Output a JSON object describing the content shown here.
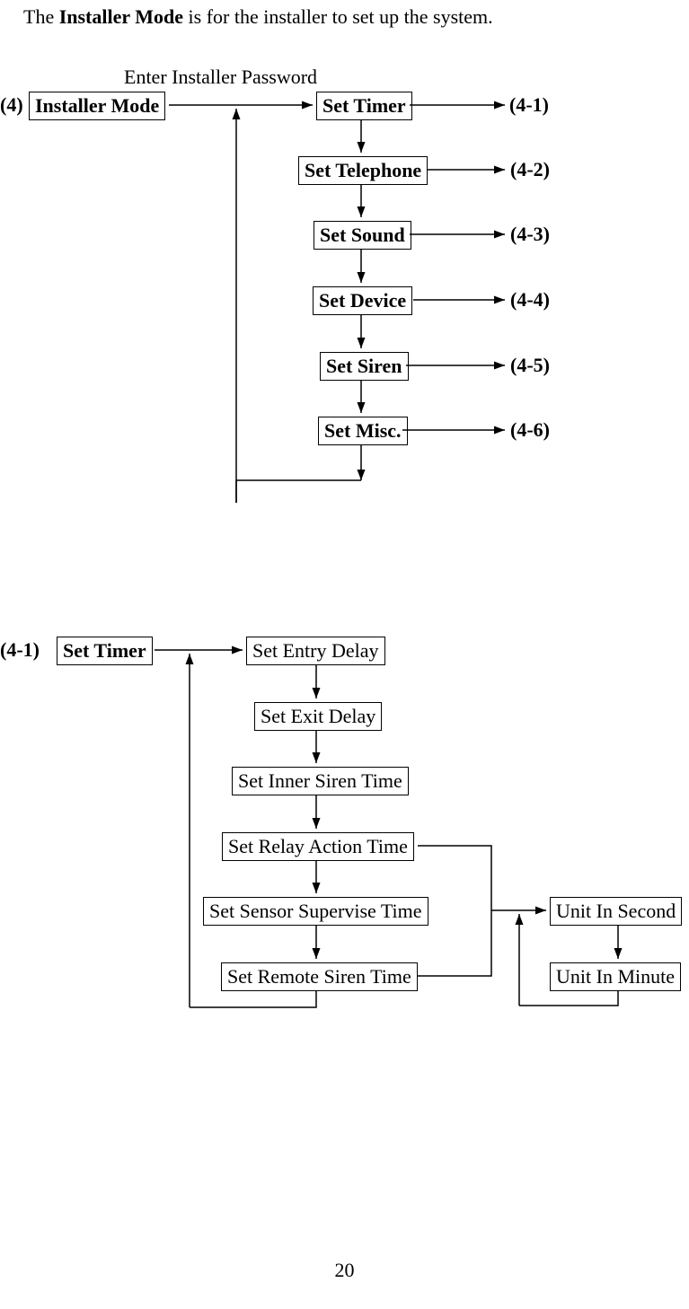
{
  "intro_prefix": "The ",
  "intro_bold": "Installer Mode",
  "intro_suffix": " is for the installer to set up the system.",
  "password_label": "Enter Installer Password",
  "d1": {
    "root_ref": "(4)",
    "root_label": "Installer Mode",
    "items": [
      {
        "label": "Set Timer",
        "ref": "(4-1)"
      },
      {
        "label": "Set Telephone",
        "ref": "(4-2)"
      },
      {
        "label": "Set Sound",
        "ref": "(4-3)"
      },
      {
        "label": "Set Device",
        "ref": "(4-4)"
      },
      {
        "label": "Set Siren",
        "ref": "(4-5)"
      },
      {
        "label": "Set Misc.",
        "ref": "(4-6)"
      }
    ]
  },
  "d2": {
    "root_ref": "(4-1)",
    "root_label": "Set Timer",
    "items": [
      "Set Entry Delay",
      "Set Exit Delay",
      "Set Inner Siren Time",
      "Set Relay Action Time",
      "Set Sensor Supervise Time",
      "Set Remote Siren Time"
    ],
    "units": [
      "Unit In Second",
      "Unit In Minute"
    ]
  },
  "page_number": "20"
}
